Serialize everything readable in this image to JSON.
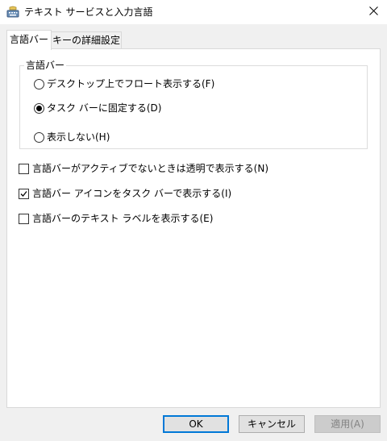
{
  "window": {
    "title": "テキスト サービスと入力言語",
    "close_symbol": "✕"
  },
  "tabs": [
    {
      "label": "言語バー",
      "active": true
    },
    {
      "label": "キーの詳細設定",
      "active": false
    }
  ],
  "group": {
    "label": "言語バー",
    "options": [
      {
        "label": "デスクトップ上でフロート表示する(F)",
        "checked": false
      },
      {
        "label": "タスク バーに固定する(D)",
        "checked": true
      },
      {
        "label": "表示しない(H)",
        "checked": false
      }
    ]
  },
  "checkboxes": [
    {
      "label": "言語バーがアクティブでないときは透明で表示する(N)",
      "checked": false
    },
    {
      "label": "言語バー アイコンをタスク バーで表示する(I)",
      "checked": true
    },
    {
      "label": "言語バーのテキスト ラベルを表示する(E)",
      "checked": false
    }
  ],
  "buttons": {
    "ok": "OK",
    "cancel": "キャンセル",
    "apply": "適用(A)"
  },
  "colors": {
    "accent": "#0078d7",
    "dialog_bg": "#f0f0f0",
    "panel_bg": "#ffffff",
    "disabled_text": "#838383"
  }
}
